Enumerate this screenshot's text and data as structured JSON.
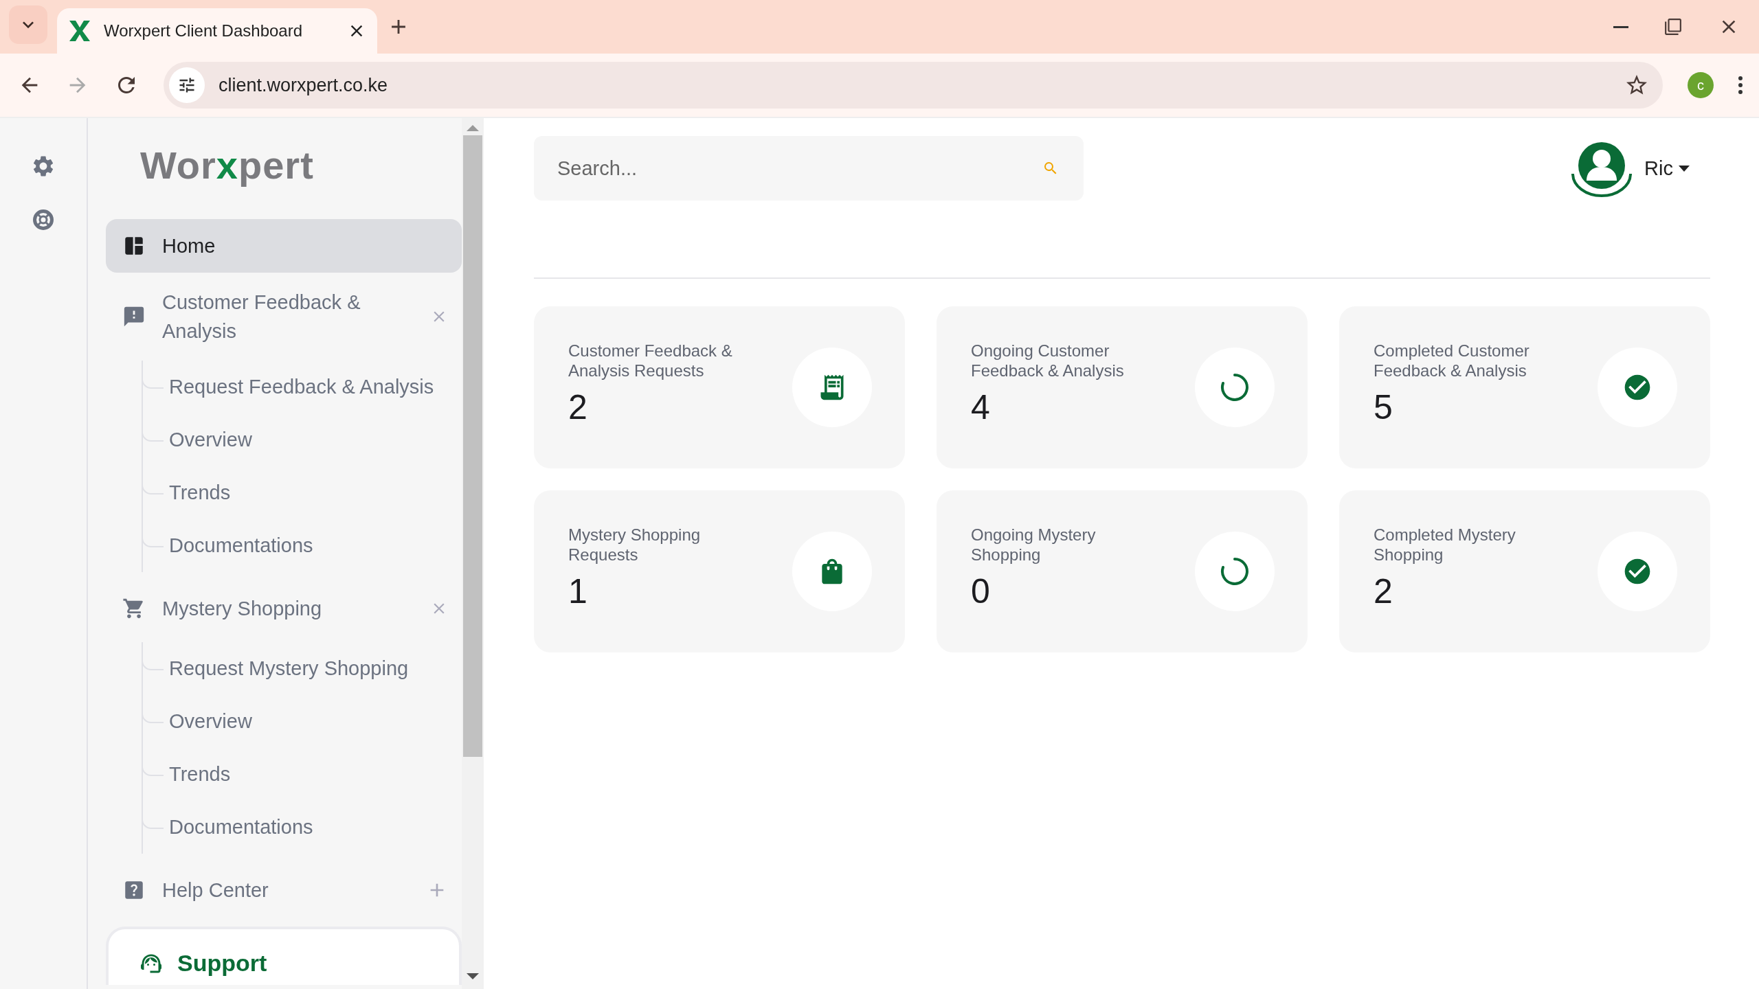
{
  "browser": {
    "tab_title": "Worxpert Client Dashboard",
    "url": "client.worxpert.co.ke",
    "profile_initial": "c"
  },
  "sidebar": {
    "logo": {
      "before": "Wor",
      "accent": "x",
      "after": "pert"
    },
    "items": [
      {
        "label": "Home",
        "kind": "dashboard",
        "selected": true
      },
      {
        "label": "Customer Feedback & Analysis",
        "kind": "feedback",
        "selected": false,
        "expanded": true,
        "children": [
          {
            "label": "Request Feedback & Analysis"
          },
          {
            "label": "Overview"
          },
          {
            "label": "Trends"
          },
          {
            "label": "Documentations"
          }
        ]
      },
      {
        "label": "Mystery Shopping",
        "kind": "cart",
        "selected": false,
        "expanded": true,
        "children": [
          {
            "label": "Request Mystery Shopping"
          },
          {
            "label": "Overview"
          },
          {
            "label": "Trends"
          },
          {
            "label": "Documentations"
          }
        ]
      },
      {
        "label": "Help Center",
        "kind": "help",
        "selected": false,
        "expanded": false
      }
    ],
    "support_card": {
      "title": "Support"
    }
  },
  "header": {
    "search": {
      "placeholder": "Search..."
    },
    "user": {
      "name": "Ric"
    }
  },
  "cards": [
    {
      "title": "Customer Feedback & Analysis Requests",
      "value": "2",
      "kind": "receipt"
    },
    {
      "title": "Ongoing Customer Feedback & Analysis",
      "value": "4",
      "kind": "spinner"
    },
    {
      "title": "Completed Customer Feedback & Analysis",
      "value": "5",
      "kind": "check"
    },
    {
      "title": "Mystery Shopping Requests",
      "value": "1",
      "kind": "bag"
    },
    {
      "title": "Ongoing Mystery Shopping",
      "value": "0",
      "kind": "spinner"
    },
    {
      "title": "Completed Mystery Shopping",
      "value": "2",
      "kind": "check"
    }
  ]
}
